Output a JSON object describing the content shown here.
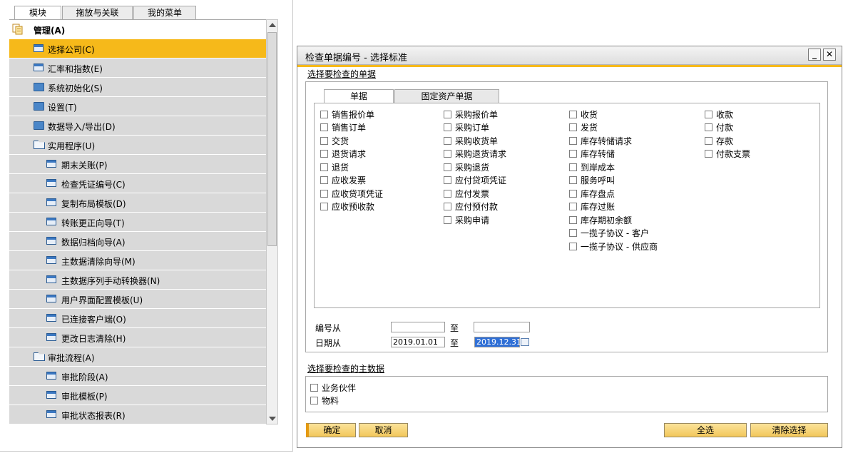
{
  "left_panel": {
    "tabs": [
      "模块",
      "拖放与关联",
      "我的菜单"
    ],
    "active_tab": 0,
    "items": [
      {
        "label": "管理(A)",
        "level": 0,
        "icon": "admin-module-icon",
        "root": true
      },
      {
        "label": "选择公司(C)",
        "level": 1,
        "icon": "page-icon",
        "selected": true
      },
      {
        "label": "汇率和指数(E)",
        "level": 1,
        "icon": "page-icon"
      },
      {
        "label": "系统初始化(S)",
        "level": 1,
        "icon": "folder-icon"
      },
      {
        "label": "设置(T)",
        "level": 1,
        "icon": "folder-icon"
      },
      {
        "label": "数据导入/导出(D)",
        "level": 1,
        "icon": "folder-icon"
      },
      {
        "label": "实用程序(U)",
        "level": 1,
        "icon": "folder-open-icon"
      },
      {
        "label": "期末关账(P)",
        "level": 2,
        "icon": "page-icon"
      },
      {
        "label": "检查凭证编号(C)",
        "level": 2,
        "icon": "page-icon"
      },
      {
        "label": "复制布局模板(D)",
        "level": 2,
        "icon": "page-icon"
      },
      {
        "label": "转账更正向导(T)",
        "level": 2,
        "icon": "page-icon"
      },
      {
        "label": "数据归档向导(A)",
        "level": 2,
        "icon": "page-icon"
      },
      {
        "label": "主数据清除向导(M)",
        "level": 2,
        "icon": "page-icon"
      },
      {
        "label": "主数据序列手动转换器(N)",
        "level": 2,
        "icon": "page-icon"
      },
      {
        "label": "用户界面配置模板(U)",
        "level": 2,
        "icon": "page-icon"
      },
      {
        "label": "已连接客户端(O)",
        "level": 2,
        "icon": "page-icon"
      },
      {
        "label": "更改日志清除(H)",
        "level": 2,
        "icon": "page-icon"
      },
      {
        "label": "审批流程(A)",
        "level": 1,
        "icon": "folder-open-icon"
      },
      {
        "label": "审批阶段(A)",
        "level": 2,
        "icon": "page-icon"
      },
      {
        "label": "审批模板(P)",
        "level": 2,
        "icon": "page-icon"
      },
      {
        "label": "审批状态报表(R)",
        "level": 2,
        "icon": "page-icon"
      }
    ]
  },
  "dialog": {
    "title": "检查单据编号 - 选择标准",
    "minimize_label": "_",
    "close_label": "✕",
    "docs_section_label": "选择要检查的单据",
    "doc_tabs": [
      "单据",
      "固定资产单据"
    ],
    "columns": [
      [
        "销售报价单",
        "销售订单",
        "交货",
        "退货请求",
        "退货",
        "应收发票",
        "应收贷项凭证",
        "应收预收款"
      ],
      [
        "采购报价单",
        "采购订单",
        "采购收货单",
        "采购退货请求",
        "采购退货",
        "应付贷项凭证",
        "应付发票",
        "应付预付款",
        "采购申请"
      ],
      [
        "收货",
        "发货",
        "库存转储请求",
        "库存转储",
        "到岸成本",
        "服务呼叫",
        "库存盘点",
        "库存过账",
        "库存期初余额",
        "一揽子协议 - 客户",
        "一揽子协议 - 供应商"
      ],
      [
        "收款",
        "付款",
        "存款",
        "付款支票"
      ]
    ],
    "number_from_label": "编号从",
    "number_to_label": "至",
    "number_from_value": "",
    "number_to_value": "",
    "date_from_label": "日期从",
    "date_to_label": "至",
    "date_from_value": "2019.01.01",
    "date_to_value": "2019.12.31",
    "master_section_label": "选择要检查的主数据",
    "master_items": [
      "业务伙伴",
      "物料"
    ],
    "buttons": {
      "ok": "确定",
      "cancel": "取消",
      "select_all": "全选",
      "clear": "清除选择"
    }
  }
}
